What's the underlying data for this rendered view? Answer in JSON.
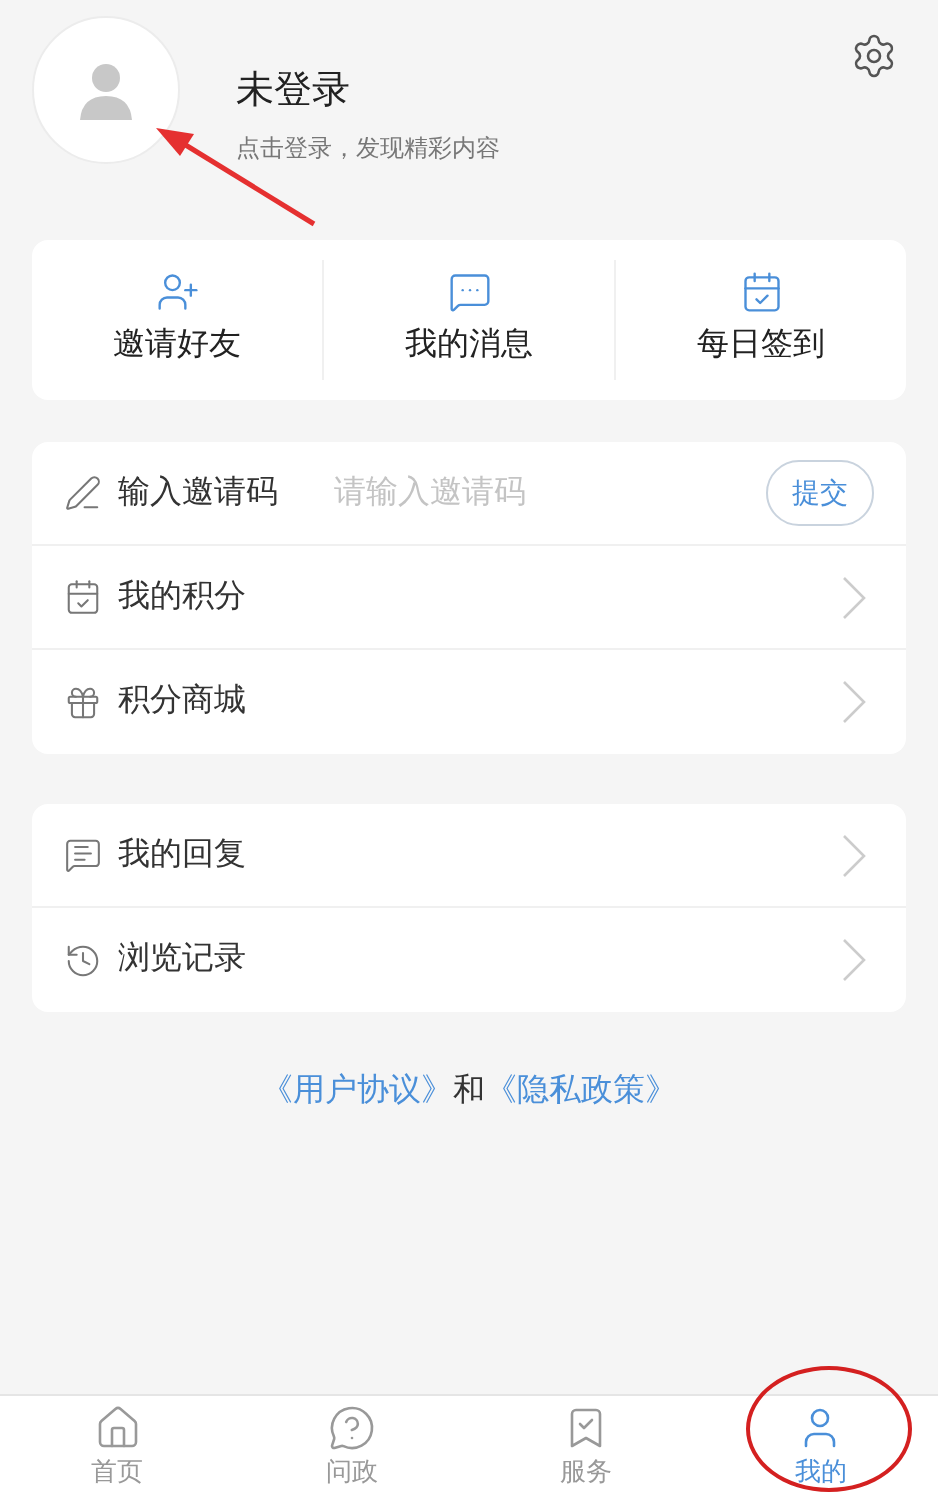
{
  "profile": {
    "name": "未登录",
    "hint": "点击登录，发现精彩内容"
  },
  "quick_actions": [
    {
      "label": "邀请好友"
    },
    {
      "label": "我的消息"
    },
    {
      "label": "每日签到"
    }
  ],
  "menu_groups": [
    {
      "items": [
        {
          "kind": "input",
          "label": "输入邀请码",
          "placeholder": "请输入邀请码",
          "button": "提交"
        },
        {
          "kind": "link",
          "label": "我的积分"
        },
        {
          "kind": "link",
          "label": "积分商城"
        }
      ]
    },
    {
      "items": [
        {
          "kind": "link",
          "label": "我的回复"
        },
        {
          "kind": "link",
          "label": "浏览记录"
        }
      ]
    }
  ],
  "agreement": {
    "first_link": "《用户协议》",
    "joiner": "和",
    "second_link": "《隐私政策》"
  },
  "tab_bar": [
    {
      "label": "首页",
      "selected": false
    },
    {
      "label": "问政",
      "selected": false
    },
    {
      "label": "服务",
      "selected": false
    },
    {
      "label": "我的",
      "selected": true
    }
  ]
}
